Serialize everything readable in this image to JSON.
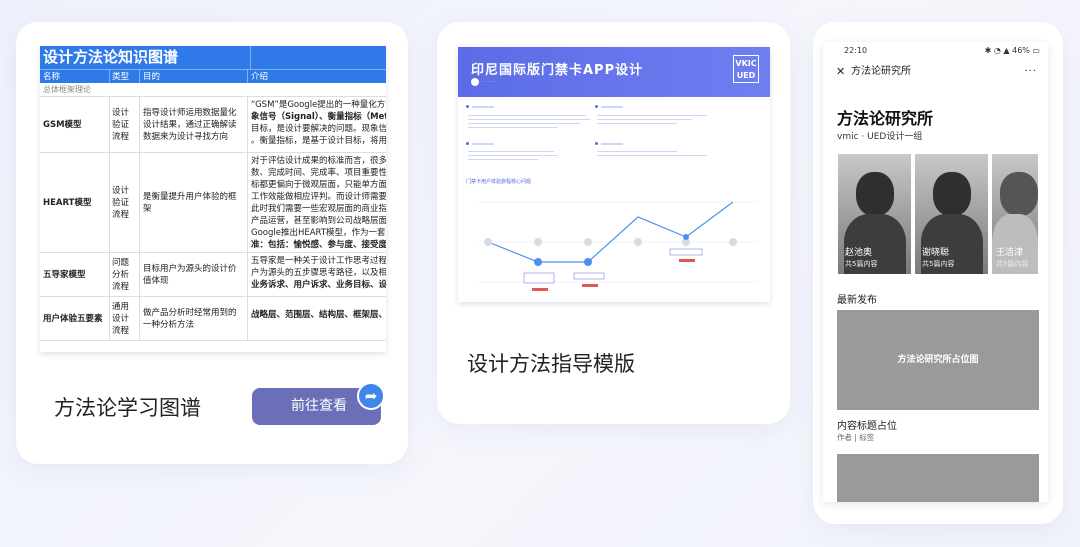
{
  "card1": {
    "table": {
      "title": "设计方法论知识图谱",
      "headers": [
        "名称",
        "类型",
        "目的",
        "介绍"
      ],
      "section": "总体框架理论",
      "rows": [
        {
          "name": "GSM模型",
          "type": "设计验证流程",
          "purpose": "指导设计师运用数据量化设计结果，通过正确解读数据来为设计寻找方向",
          "intro": [
            "“GSM”是Google提出的一种量化方法",
            "象信号（Signal）、衡量指标（Metri",
            "目标，是设计要解决的问题。现象信号",
            "。衡量指标，是基于设计目标，将用户"
          ]
        },
        {
          "name": "HEART模型",
          "type": "设计验证流程",
          "purpose": "是衡量提升用户体验的框架",
          "intro": [
            "对于评估设计成果的标准而言，很多用",
            "数、完成时间、完成率、项目重要性等",
            "标都更偏向于微观层面，只能单方面的",
            "工作效能做相应评判。而设计师需要的",
            "此时我们需要一些宏观层面的商业指标",
            "产品运营，甚至影响到公司战略层面。",
            "Google推出HEART模型，作为一套完",
            "准：包括：愉悦感、参与度、接受度、"
          ]
        },
        {
          "name": "五导家模型",
          "type": "问题分析流程",
          "purpose": "目标用户为源头的设计价值体现",
          "intro": [
            "五导家是一种关于设计工作思考过程的",
            "户为源头的五步骤思考路径，以及相关",
            "业务诉求、用户诉求、业务目标、设计"
          ]
        },
        {
          "name": "用户体验五要素",
          "type": "通用设计流程",
          "purpose": "做产品分析时经常用到的一种分析方法",
          "intro": [
            "战略层、范围层、结构层、框架层、表"
          ]
        }
      ]
    },
    "label": "方法论学习图谱",
    "button": "前往查看"
  },
  "card2": {
    "doc_title": "印尼国际版门禁卡APP设计",
    "logo_line1": "VKIC",
    "logo_line2": "UED",
    "chart_title": "门禁卡用户体验旅程核心问题",
    "label": "设计方法指导模版"
  },
  "card3": {
    "status_time": "22:10",
    "status_right": "46%",
    "nav_title": "方法论研究所",
    "page_title": "方法论研究所",
    "subtitle": "vmic · UED设计一组",
    "profiles": [
      {
        "name": "赵池奥",
        "count": "共5篇内容"
      },
      {
        "name": "谢晓聪",
        "count": "共5篇内容"
      },
      {
        "name": "王洁津",
        "count": "共5篇内容"
      }
    ],
    "latest_label": "最新发布",
    "placeholder_text": "方法论研究所占位图",
    "post_title": "内容标题占位",
    "post_meta": "作者 | 标签"
  }
}
